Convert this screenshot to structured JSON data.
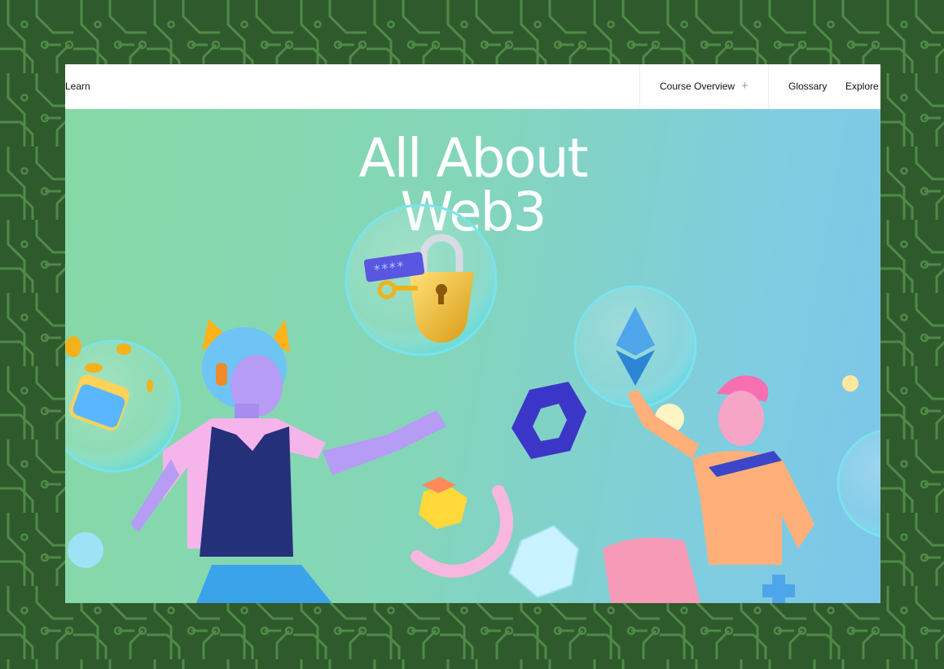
{
  "nav": {
    "learn_label": "Learn",
    "course_overview_label": "Course Overview",
    "course_overview_icon": "plus-icon",
    "glossary_label": "Glossary",
    "explore_label": "Explore"
  },
  "hero": {
    "title_line1": "All About",
    "title_line2": "Web3"
  },
  "colors": {
    "background": "#2f5a2c",
    "circuit": "#4f8a47",
    "hero_gradient_start": "#86d9a6",
    "hero_gradient_end": "#7cc6ea",
    "title": "#ffffff"
  },
  "illustration": {
    "elements": [
      "wallet-coins-bubble",
      "lock-password-bubble",
      "ethereum-bubble",
      "fox-ear-character",
      "pink-hair-character",
      "blue-ring-shape",
      "pink-arc-shape",
      "yellow-cube-shape",
      "ice-crystal-shape",
      "blue-cross-shape"
    ]
  }
}
